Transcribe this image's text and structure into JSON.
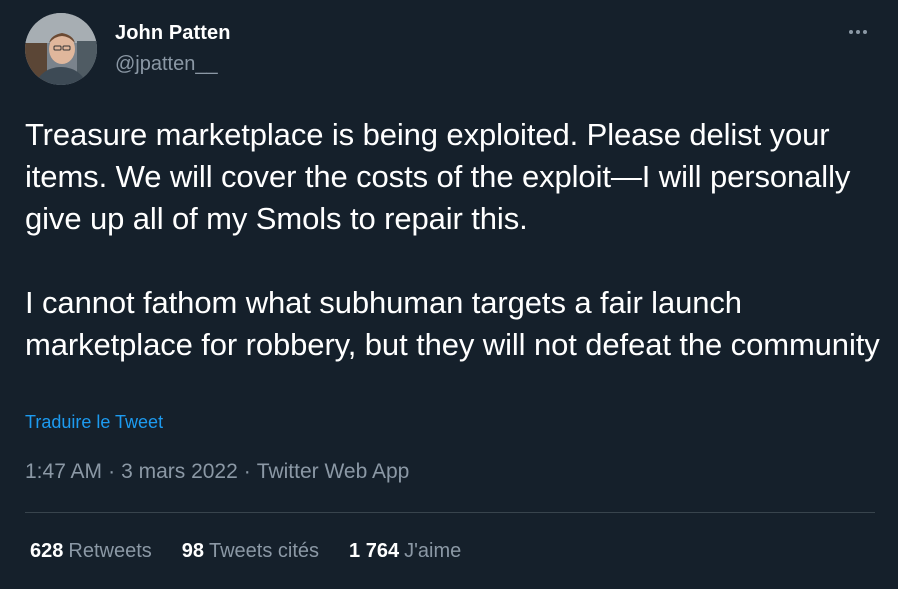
{
  "author": {
    "name": "John Patten",
    "handle": "@jpatten__",
    "avatar_icon": "profile-photo"
  },
  "tweet": {
    "text": "Treasure marketplace is being exploited. Please delist your items. We will cover the costs of the exploit—I will personally give up all of my Smols to repair this.\n\nI cannot fathom what subhuman targets a fair launch marketplace for robbery, but they will not defeat the community",
    "translate_label": "Traduire le Tweet",
    "time": "1:47 AM",
    "date": "3 mars 2022",
    "source": "Twitter Web App",
    "separator": "·"
  },
  "stats": {
    "retweets": {
      "count": "628",
      "label": "Retweets"
    },
    "quotes": {
      "count": "98",
      "label": "Tweets cités"
    },
    "likes": {
      "count": "1 764",
      "label": "J'aime"
    }
  },
  "colors": {
    "background": "#15202b",
    "primary_text": "#ffffff",
    "secondary_text": "#8b98a5",
    "link": "#1d9bf0",
    "divider": "#38444d"
  },
  "icons": {
    "more": "more-dots-icon"
  }
}
